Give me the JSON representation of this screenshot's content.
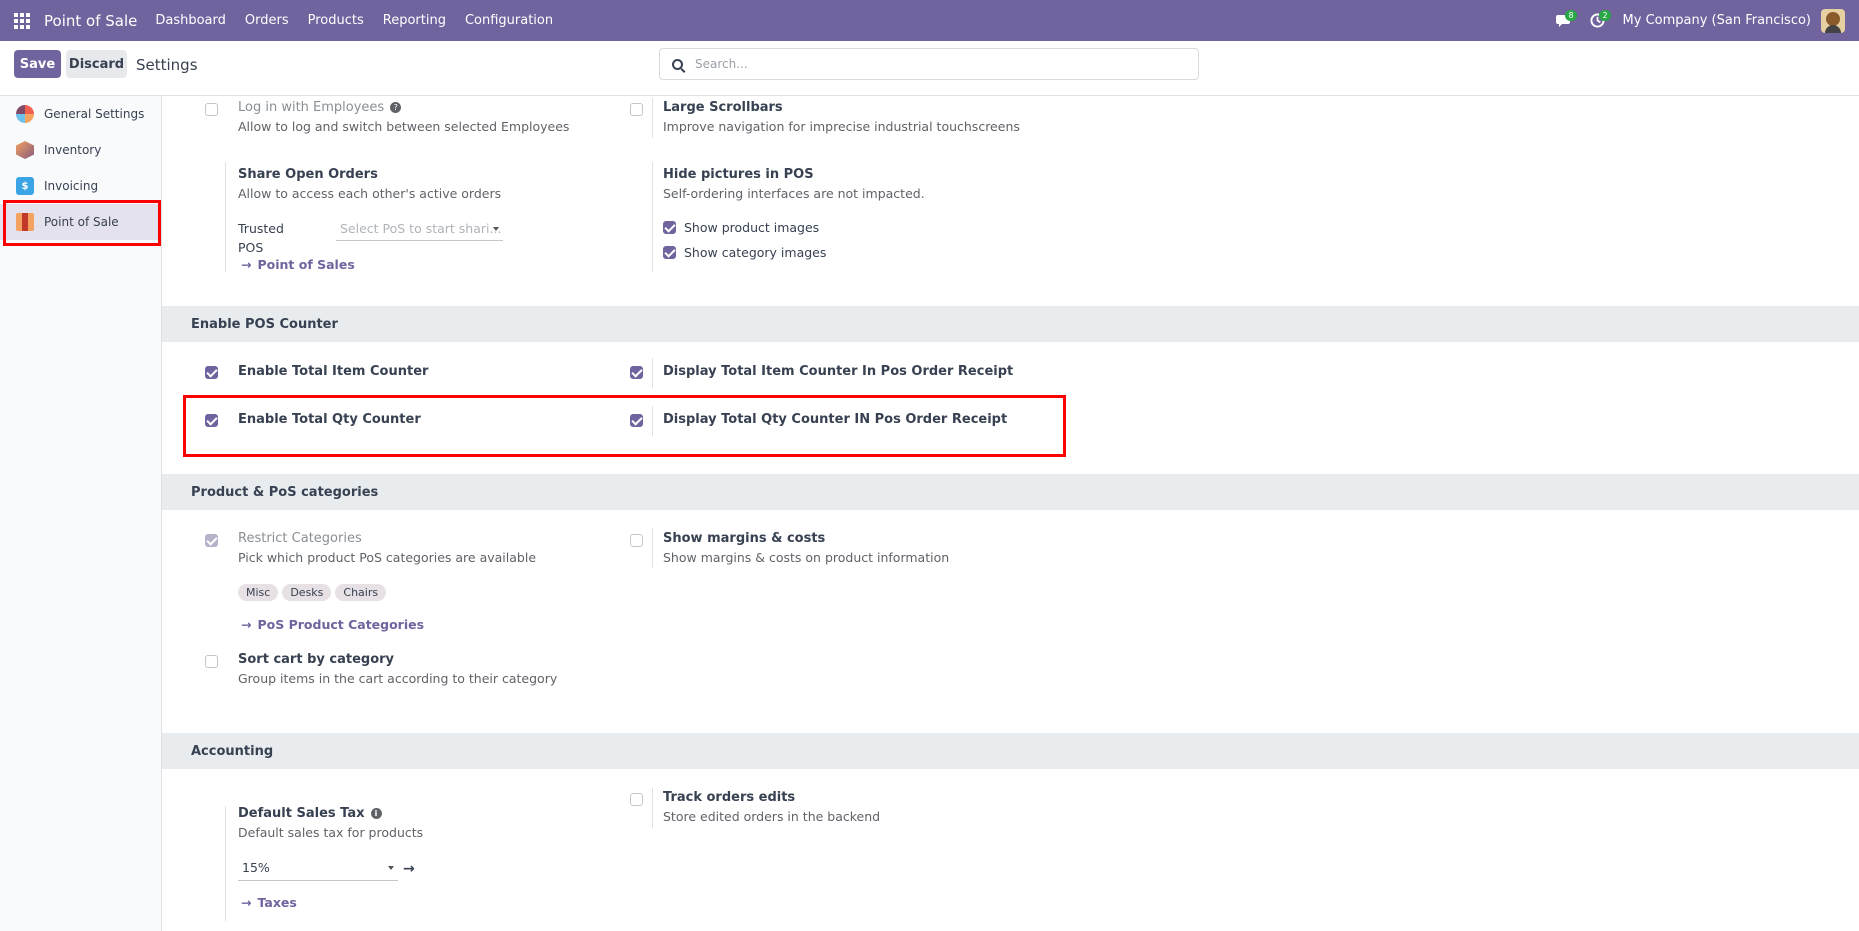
{
  "navbar": {
    "brand": "Point of Sale",
    "menu": [
      "Dashboard",
      "Orders",
      "Products",
      "Reporting",
      "Configuration"
    ],
    "messages_badge": "8",
    "activity_badge": "2",
    "company": "My Company (San Francisco)"
  },
  "control": {
    "save": "Save",
    "discard": "Discard",
    "title": "Settings",
    "search_placeholder": "Search..."
  },
  "sidebar": {
    "items": [
      {
        "label": "General Settings",
        "icon": "general-settings-icon"
      },
      {
        "label": "Inventory",
        "icon": "inventory-icon"
      },
      {
        "label": "Invoicing",
        "icon": "invoicing-icon"
      },
      {
        "label": "Point of Sale",
        "icon": "point-of-sale-icon",
        "active": true
      }
    ]
  },
  "top_settings": {
    "login_employees": {
      "title": "Log in with Employees",
      "desc": "Allow to log and switch between selected Employees",
      "checked": false
    },
    "large_scrollbars": {
      "title": "Large Scrollbars",
      "desc": "Improve navigation for imprecise industrial touchscreens",
      "checked": false
    },
    "share_orders": {
      "title": "Share Open Orders",
      "desc": "Allow to access each other's active orders",
      "trusted_label_1": "Trusted",
      "trusted_label_2": "POS",
      "trusted_placeholder": "Select PoS to start shari...",
      "link": "Point of Sales"
    },
    "hide_pictures": {
      "title": "Hide pictures in POS",
      "desc": "Self-ordering interfaces are not impacted.",
      "show_product": "Show product images",
      "show_category": "Show category images"
    }
  },
  "pos_counter": {
    "heading": "Enable POS Counter",
    "item_counter": {
      "title": "Enable Total Item Counter",
      "checked": true
    },
    "item_receipt": {
      "title": "Display Total Item Counter In Pos Order Receipt",
      "checked": true
    },
    "qty_counter": {
      "title": "Enable Total Qty Counter",
      "checked": true
    },
    "qty_receipt": {
      "title": "Display Total Qty Counter IN Pos Order Receipt",
      "checked": true
    }
  },
  "categories": {
    "heading": "Product & PoS categories",
    "restrict": {
      "title": "Restrict Categories",
      "desc": "Pick which product PoS categories are available",
      "tags": [
        "Misc",
        "Desks",
        "Chairs"
      ],
      "link": "PoS Product Categories"
    },
    "margins": {
      "title": "Show margins & costs",
      "desc": "Show margins & costs on product information"
    },
    "sort_cart": {
      "title": "Sort cart by category",
      "desc": "Group items in the cart according to their category"
    }
  },
  "accounting": {
    "heading": "Accounting",
    "sales_tax": {
      "title": "Default Sales Tax",
      "desc": "Default sales tax for products",
      "value": "15%",
      "link": "Taxes"
    },
    "track_edits": {
      "title": "Track orders edits",
      "desc": "Store edited orders in the backend"
    }
  }
}
